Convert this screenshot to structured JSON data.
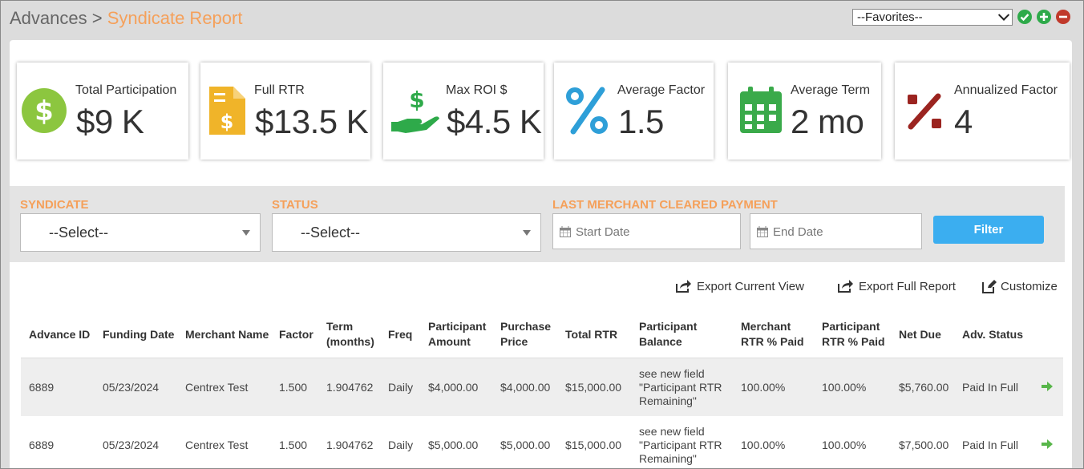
{
  "breadcrumb": {
    "parent": "Advances",
    "separator": " > ",
    "current": "Syndicate Report"
  },
  "favorites": {
    "selected": "--Favorites--"
  },
  "colors": {
    "accent": "#f5a05a",
    "green": "#2eaa4a",
    "red": "#c0392b",
    "blue": "#3baef0"
  },
  "cards": [
    {
      "label": "Total Participation",
      "value": "$9 K",
      "icon": "dollar-circle-icon"
    },
    {
      "label": "Full RTR",
      "value": "$13.5 K",
      "icon": "invoice-dollar-icon"
    },
    {
      "label": "Max ROI $",
      "value": "$4.5 K",
      "icon": "hand-dollar-icon"
    },
    {
      "label": "Average Factor",
      "value": "1.5",
      "icon": "percent-icon"
    },
    {
      "label": "Average Term",
      "value": "2 mo",
      "icon": "calendar-icon"
    },
    {
      "label": "Annualized Factor",
      "value": "4",
      "icon": "percent-slash-icon"
    }
  ],
  "filters": {
    "syndicate_label": "SYNDICATE",
    "syndicate_value": "--Select--",
    "status_label": "STATUS",
    "status_value": "--Select--",
    "payment_label": "LAST MERCHANT CLEARED PAYMENT",
    "start_placeholder": "Start Date",
    "end_placeholder": "End Date",
    "filter_button": "Filter"
  },
  "actions": {
    "export_current": "Export Current View",
    "export_full": "Export Full Report",
    "customize": "Customize"
  },
  "table": {
    "headers": {
      "advance_id": "Advance ID",
      "funding_date": "Funding Date",
      "merchant_name": "Merchant Name",
      "factor": "Factor",
      "term_1": "Term",
      "term_2": "(months)",
      "freq": "Freq",
      "pa_1": "Participant",
      "pa_2": "Amount",
      "pp_1": "Purchase",
      "pp_2": "Price",
      "total_rtr": "Total RTR",
      "pb_1": "Participant",
      "pb_2": "Balance",
      "mrp_1": "Merchant",
      "mrp_2": "RTR % Paid",
      "prp_1": "Participant",
      "prp_2": "RTR % Paid",
      "net_due": "Net Due",
      "adv_status": "Adv. Status"
    },
    "rows": [
      {
        "advance_id": "6889",
        "funding_date": "05/23/2024",
        "merchant_name": "Centrex Test",
        "factor": "1.500",
        "term": "1.904762",
        "freq": "Daily",
        "participant_amount": "$4,000.00",
        "purchase_price": "$4,000.00",
        "total_rtr": "$15,000.00",
        "balance_1": "see new field",
        "balance_2": "\"Participant RTR",
        "balance_3": "Remaining\"",
        "merchant_rtr_paid": "100.00%",
        "participant_rtr_paid": "100.00%",
        "net_due": "$5,760.00",
        "adv_status": "Paid In Full"
      },
      {
        "advance_id": "6889",
        "funding_date": "05/23/2024",
        "merchant_name": "Centrex Test",
        "factor": "1.500",
        "term": "1.904762",
        "freq": "Daily",
        "participant_amount": "$5,000.00",
        "purchase_price": "$5,000.00",
        "total_rtr": "$15,000.00",
        "balance_1": "see new field",
        "balance_2": "\"Participant RTR",
        "balance_3": "Remaining\"",
        "merchant_rtr_paid": "100.00%",
        "participant_rtr_paid": "100.00%",
        "net_due": "$7,500.00",
        "adv_status": "Paid In Full"
      }
    ]
  }
}
